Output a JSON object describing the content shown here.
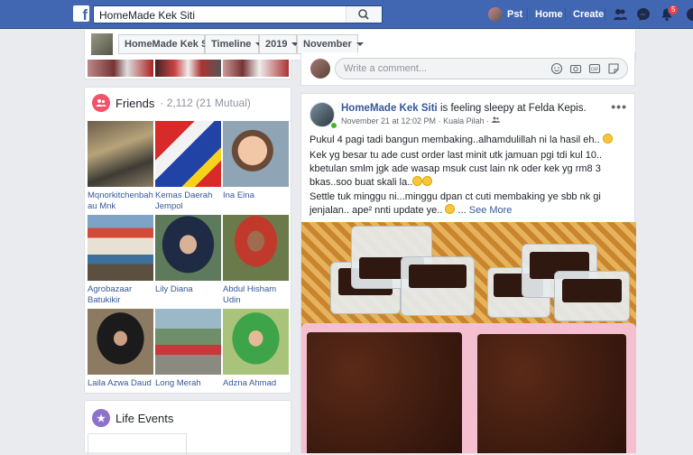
{
  "topbar": {
    "search_value": "HomeMade Kek Siti",
    "user_label": "Pst",
    "home_label": "Home",
    "create_label": "Create",
    "notification_count": "5"
  },
  "subnav": {
    "page_name": "HomeMade Kek Siti",
    "timeline_label": "Timeline",
    "year": "2019",
    "month": "November"
  },
  "friends": {
    "title": "Friends",
    "count": "· 2,112 (21 Mutual)",
    "items": [
      {
        "name": "Mqnorkitchenbahau Mnk"
      },
      {
        "name": "Kemas Daerah Jempol"
      },
      {
        "name": "Ina Eina"
      },
      {
        "name": "Agrobazaar Batukikir"
      },
      {
        "name": "Lily Diana"
      },
      {
        "name": "Abdul Hisham Udin"
      },
      {
        "name": "Laila Azwa Daud"
      },
      {
        "name": "Long Merah"
      },
      {
        "name": "Adzna Ahmad"
      }
    ]
  },
  "life_events": {
    "title": "Life Events"
  },
  "comment": {
    "placeholder": "Write a comment..."
  },
  "post": {
    "author": "HomeMade Kek Siti",
    "activity": "is  feeling sleepy at Felda Kepis.",
    "date": "November 21 at 12:02 PM",
    "location": "· Kuala Pilah ·",
    "line1": "Pukul 4 pagi tadi bangun membaking..alhamdulillah ni la hasil eh..",
    "line2": "Kek yg besar tu ade cust order last minit utk jamuan pgi tdi kul 10.. kbetulan smlm jgk ade wasap msuk cust lain nk oder kek yg rm8 3 bkas..soo buat skali la..",
    "line3": "Settle tuk minggu ni...minggu dpan ct cuti membaking ye sbb nk gi jenjalan.. ape² nnti update ye..",
    "see_more": "See More"
  },
  "colors": {
    "brand": "#4267b2",
    "link": "#365899",
    "notification": "#fa3e3e"
  }
}
